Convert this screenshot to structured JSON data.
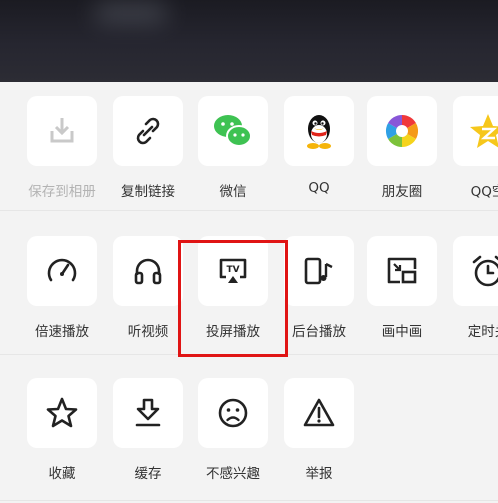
{
  "share_row": [
    {
      "label": "保存到相册",
      "icon": "save-to-album-icon",
      "disabled": true
    },
    {
      "label": "复制链接",
      "icon": "link-icon"
    },
    {
      "label": "微信",
      "icon": "wechat-icon",
      "color": "#3ec252"
    },
    {
      "label": "QQ",
      "icon": "qq-penguin-icon"
    },
    {
      "label": "朋友圈",
      "icon": "moments-icon"
    },
    {
      "label": "QQ空",
      "icon": "qzone-star-icon",
      "color": "#f6c71b"
    }
  ],
  "function_row": [
    {
      "label": "倍速播放",
      "icon": "speedometer-icon"
    },
    {
      "label": "听视频",
      "icon": "headphones-icon"
    },
    {
      "label": "投屏播放",
      "icon": "tv-cast-icon",
      "highlighted": true
    },
    {
      "label": "后台播放",
      "icon": "background-play-icon"
    },
    {
      "label": "画中画",
      "icon": "picture-in-picture-icon"
    },
    {
      "label": "定时关",
      "icon": "alarm-clock-icon"
    }
  ],
  "action_row": [
    {
      "label": "收藏",
      "icon": "star-outline-icon"
    },
    {
      "label": "缓存",
      "icon": "download-icon"
    },
    {
      "label": "不感兴趣",
      "icon": "sad-face-icon"
    },
    {
      "label": "举报",
      "icon": "warning-triangle-icon"
    }
  ],
  "colors": {
    "highlight_border": "#e01414",
    "tile": "#ffffff",
    "sheet": "#f3f3f3"
  }
}
